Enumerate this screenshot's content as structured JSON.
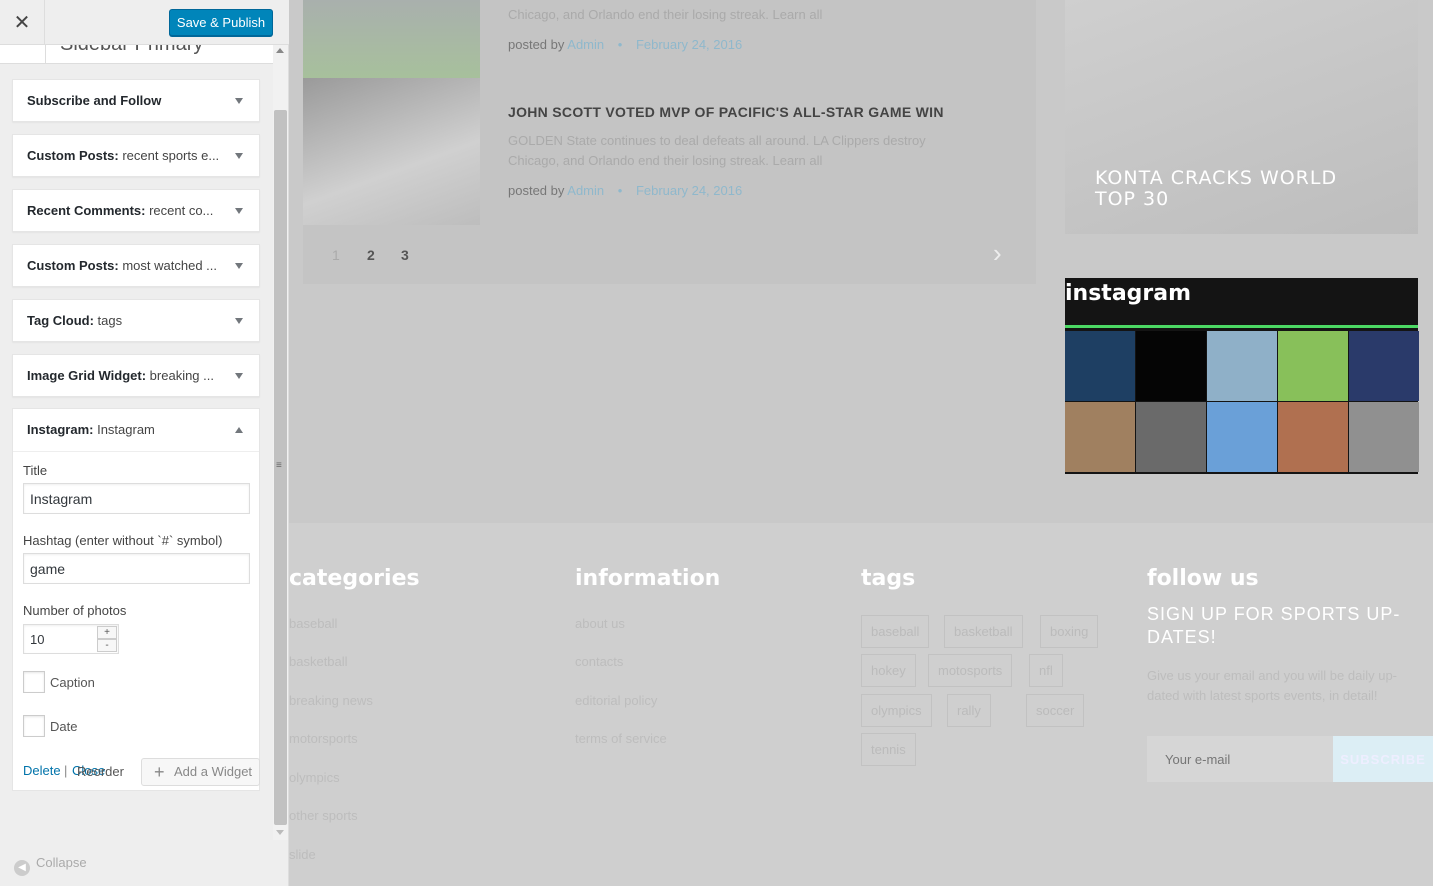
{
  "customizer": {
    "close_glyph": "✕",
    "save_label": "Save & Publish",
    "section_title": "Sidebar Primary",
    "widgets": [
      {
        "type": "Subscribe and Follow",
        "name": ""
      },
      {
        "type": "Custom Posts:",
        "name": " recent sports e..."
      },
      {
        "type": "Recent Comments:",
        "name": " recent co..."
      },
      {
        "type": "Custom Posts:",
        "name": " most watched ..."
      },
      {
        "type": "Tag Cloud:",
        "name": " tags"
      },
      {
        "type": "Image Grid Widget:",
        "name": " breaking ..."
      }
    ],
    "instagram_widget": {
      "type": "Instagram:",
      "name": " Instagram",
      "title_label": "Title",
      "title_value": "Instagram",
      "hashtag_label": "Hashtag (enter without `#` symbol)",
      "hashtag_value": "game",
      "photos_label": "Number of photos",
      "photos_value": "10",
      "caption_label": "Caption",
      "date_label": "Date",
      "delete_label": "Delete",
      "separator": "|",
      "close_label": "Close"
    },
    "reorder_label": "Reorder",
    "add_widget_label": "Add a Widget",
    "collapse_label": "Collapse"
  },
  "preview": {
    "posts": [
      {
        "title": "",
        "excerpt_tail": "Chicago, and Orlando end their losing streak. Learn all",
        "posted_by": "posted by",
        "author": "Admin",
        "bullet": "•",
        "date": "February 24, 2016"
      },
      {
        "title": "JOHN SCOTT VOTED MVP OF PACIFIC'S ALL-STAR GAME WIN",
        "excerpt": "GOLDEN State continues to deal defeats all around. LA Clippers destroy Chicago, and Orlando end their losing streak. Learn all",
        "posted_by": "posted by",
        "author": "Admin",
        "bullet": "•",
        "date": "February 24, 2016"
      }
    ],
    "pagination": [
      "1",
      "2",
      "3"
    ],
    "next_glyph": "›",
    "featured_title": "KONTA CRACKS WORLD TOP 30",
    "instagram_title": "instagram",
    "instagram_tiles": [
      {
        "name": "dark-blue-figure",
        "color": "#1e3f63"
      },
      {
        "name": "black",
        "color": "#050505"
      },
      {
        "name": "skydiver",
        "color": "#8fb0c8"
      },
      {
        "name": "green-game",
        "color": "#88c05a"
      },
      {
        "name": "crowd",
        "color": "#2a3a6a"
      },
      {
        "name": "baby",
        "color": "#a08060"
      },
      {
        "name": "warcraft-book",
        "color": "#6a6a6a"
      },
      {
        "name": "minecraft",
        "color": "#6aa0d8"
      },
      {
        "name": "grenade-art",
        "color": "#b07050"
      },
      {
        "name": "bird-sketch",
        "color": "#909090"
      }
    ],
    "footer": {
      "categories_heading": "categories",
      "categories": [
        "baseball",
        "basketball",
        "breaking news",
        "motorsports",
        "olympics",
        "other sports",
        "slide"
      ],
      "information_heading": "information",
      "information": [
        "about us",
        "contacts",
        "editorial policy",
        "terms of service"
      ],
      "tags_heading": "tags",
      "tags": [
        "baseball",
        "basketball",
        "boxing",
        "hokey",
        "motosports",
        "nfl",
        "olympics",
        "rally",
        "soccer",
        "tennis"
      ],
      "follow_heading": "follow us",
      "signup_heading": "SIGN UP FOR SPORTS UP-DATES!",
      "signup_text": "Give us your email and you will be daily up-dated with latest sports events, in detail!",
      "email_placeholder": "Your e-mail",
      "subscribe_label": "SUBSCRIBE"
    }
  }
}
